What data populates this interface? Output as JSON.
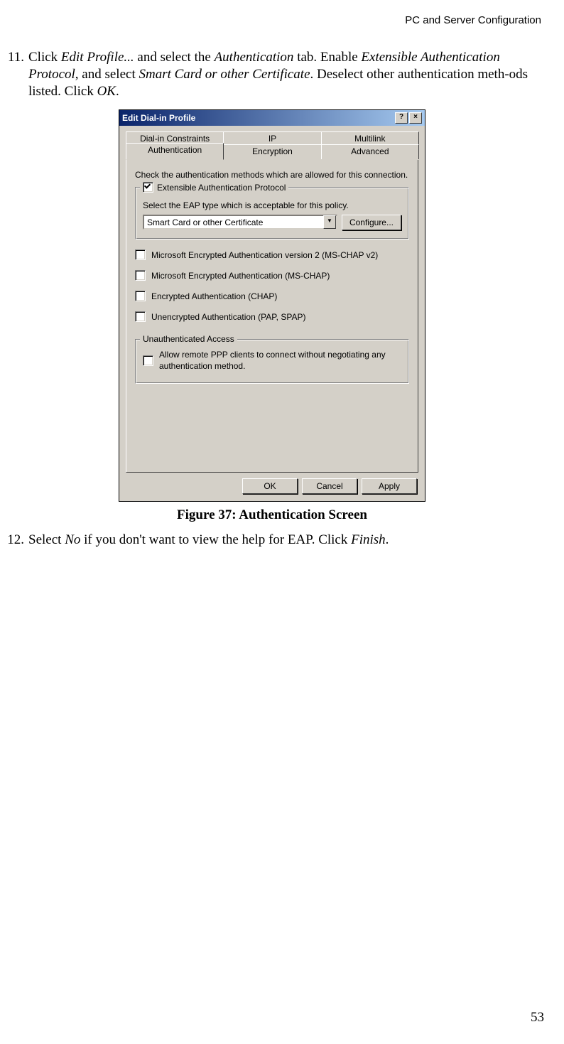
{
  "header": "PC and Server Configuration",
  "step11": {
    "num": "11.",
    "t1": "Click ",
    "i1": "Edit Profile...",
    "t2": " and select the ",
    "i2": "Authentication",
    "t3": " tab. Enable ",
    "i3": "Extensible Authentication Protocol",
    "t4": ", and select ",
    "i4": "Smart Card or other Certificate",
    "t5": ". Deselect other authentication meth-ods listed. Click ",
    "i5": "OK",
    "t6": "."
  },
  "dialog": {
    "title": "Edit Dial-in Profile",
    "help": "?",
    "close": "×",
    "tabs_back": [
      "Dial-in Constraints",
      "IP",
      "Multilink"
    ],
    "tabs_front": [
      "Authentication",
      "Encryption",
      "Advanced"
    ],
    "instr": "Check the authentication methods which are allowed for this connection.",
    "eap_label": "Extensible Authentication Protocol",
    "eap_sub": "Select the EAP type which is acceptable for this policy.",
    "eap_sel": "Smart Card or other Certificate",
    "configure": "Configure...",
    "methods": [
      "Microsoft Encrypted Authentication version 2 (MS-CHAP v2)",
      "Microsoft Encrypted Authentication (MS-CHAP)",
      "Encrypted Authentication (CHAP)",
      "Unencrypted Authentication (PAP, SPAP)"
    ],
    "unauth_title": "Unauthenticated Access",
    "unauth_text": "Allow remote PPP clients to connect without negotiating any authentication method.",
    "ok": "OK",
    "cancel": "Cancel",
    "apply": "Apply"
  },
  "caption": "Figure 37: Authentication Screen",
  "step12": {
    "num": "12.",
    "t1": "Select ",
    "i1": "No",
    "t2": " if you don't want to view the help for EAP. Click ",
    "i2": "Finish",
    "t3": "."
  },
  "page_num": "53"
}
